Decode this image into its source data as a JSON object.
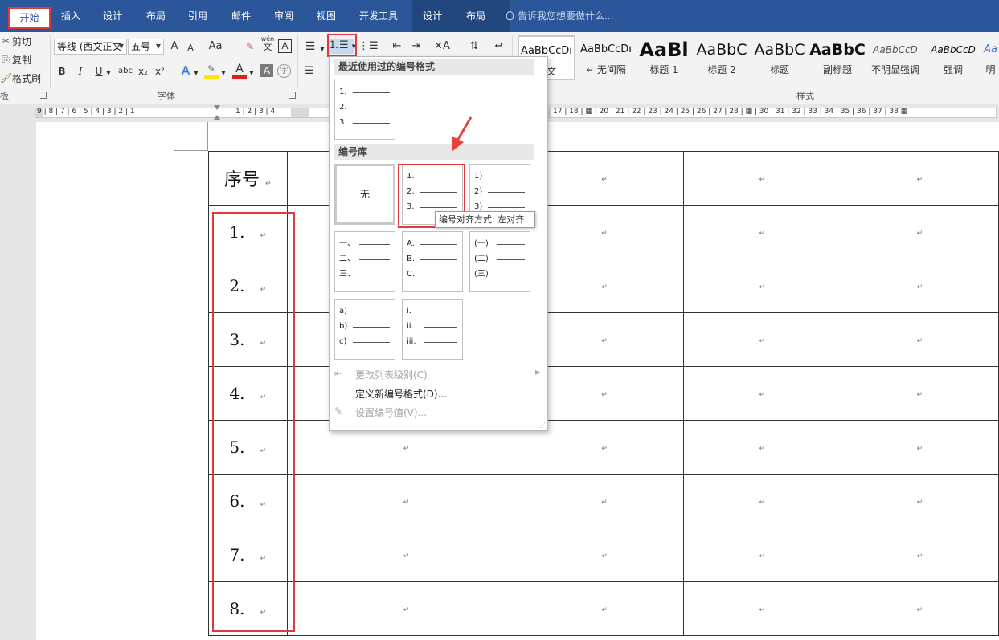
{
  "tabs": {
    "start": "开始",
    "insert": "插入",
    "design": "设计",
    "layout": "布局",
    "references": "引用",
    "mailings": "邮件",
    "review": "审阅",
    "view": "视图",
    "developer": "开发工具",
    "table_design": "设计",
    "table_layout": "布局",
    "tell_me": "告诉我您想要做什么..."
  },
  "clipboard": {
    "cut": "剪切",
    "copy": "复制",
    "format_painter": "格式刷",
    "group": "板"
  },
  "font": {
    "font_name": "等线 (西文正文",
    "font_size": "五号",
    "group": "字体",
    "grow": "A",
    "shrink": "A",
    "case": "Aa",
    "bold": "B",
    "italic": "I",
    "underline": "U",
    "strike": "abc",
    "sub": "x₂",
    "sup": "x²",
    "wen": "wén",
    "wen2": "文",
    "border_char": "A",
    "shading_char": "A",
    "font_color": "A",
    "circled": "字"
  },
  "styles": {
    "group": "样式",
    "items": [
      {
        "sample": "AaBbCcDı",
        "name": "正文"
      },
      {
        "sample": "AaBbCcDı",
        "name": "↵ 无间隔"
      },
      {
        "sample": "AaBl",
        "name": "标题 1"
      },
      {
        "sample": "AaBbC",
        "name": "标题 2"
      },
      {
        "sample": "AaBbC",
        "name": "标题"
      },
      {
        "sample": "AaBbC",
        "name": "副标题"
      },
      {
        "sample": "AaBbCcD",
        "name": "不明显强调"
      },
      {
        "sample": "AaBbCcD",
        "name": "强调"
      },
      {
        "sample": "Aa",
        "name": "明"
      }
    ]
  },
  "ruler": {
    "left": "9 | 8 | 7 | 6 | 5 | 4 | 3 | 2 | 1",
    "middle": "1 | 2 | 3 | 4",
    "right": "17 | 18 | ▦ | 20 | 21 | 22 | 23 | 24 | 25 | 26 | 27 | 28 | ▦ | 30 | 31 | 32 | 33 | 34 | 35 | 36 | 37 | 38 ▦"
  },
  "numbering_menu": {
    "recent_heading": "最近使用过的编号格式",
    "library_heading": "编号库",
    "none_label": "无",
    "recent_labels": [
      "1.",
      "2.",
      "3."
    ],
    "tiles": [
      [
        "1.",
        "2.",
        "3."
      ],
      [
        "1)",
        "2)",
        "3)"
      ],
      [
        "一、",
        "二、",
        "三、"
      ],
      [
        "A.",
        "B.",
        "C."
      ],
      [
        "(一)",
        "(二)",
        "(三)"
      ],
      [
        "a)",
        "b)",
        "c)"
      ],
      [
        "i.",
        "ii.",
        "iii."
      ]
    ],
    "tooltip": "编号对齐方式: 左对齐",
    "change_level": "更改列表级别(C)",
    "define_new": "定义新编号格式(D)...",
    "set_value": "设置编号值(V)..."
  },
  "table": {
    "header": "序号",
    "mark": "↵",
    "numbers": [
      "1.",
      "2.",
      "3.",
      "4.",
      "5.",
      "6.",
      "7.",
      "8."
    ]
  },
  "colors": {
    "ribbon_blue": "#2b579a",
    "highlight_red": "#e0393d"
  }
}
